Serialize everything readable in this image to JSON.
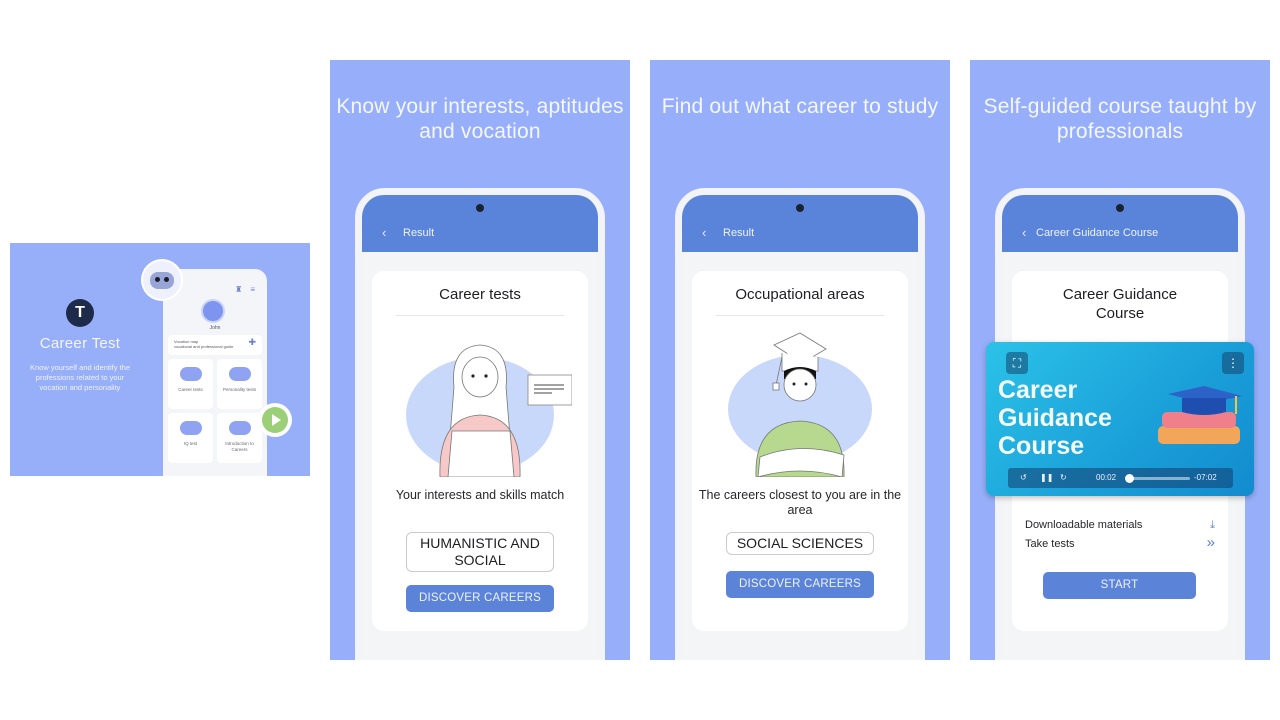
{
  "feature": {
    "logo_glyph": "T",
    "title": "Career Test",
    "description": "Know yourself and identify the professions related to your vocation and personality",
    "phone": {
      "user_name": "John",
      "vocation_map": {
        "title": "Vocation map",
        "subtitle": "vocational and professional guide"
      },
      "tiles": [
        {
          "label": "Career tests",
          "icon": "graduation-cap-icon"
        },
        {
          "label": "Personality tests",
          "icon": "hands-icon"
        },
        {
          "label": "IQ test",
          "icon": "lightbulb-icon"
        },
        {
          "label": "Introduction to Careers",
          "icon": "briefcase-icon"
        }
      ]
    }
  },
  "panels": [
    {
      "headline": "Know your interests, aptitudes and vocation",
      "appbar_title": "Result",
      "card_title": "Career tests",
      "result_label": "Your interests and skills match",
      "result_value": "HUMANISTIC AND SOCIAL",
      "button": "DISCOVER CAREERS"
    },
    {
      "headline": "Find out what career to study",
      "appbar_title": "Result",
      "card_title": "Occupational areas",
      "result_label": "The careers closest to you are in the area",
      "result_value": "SOCIAL SCIENCES",
      "button": "DISCOVER CAREERS"
    },
    {
      "headline": "Self-guided course taught by professionals",
      "appbar_title": "Career Guidance Course",
      "card_title": "Career Guidance Course",
      "video": {
        "title": "Career Guidance Course",
        "elapsed": "00:02",
        "remaining": "-07:02",
        "progress": 0.01
      },
      "rows": [
        {
          "label": "Downloadable materials",
          "icon": "download-icon",
          "glyph": "⤓"
        },
        {
          "label": "Take tests",
          "icon": "double-chevron-right-icon",
          "glyph": "»"
        }
      ],
      "button": "START"
    }
  ],
  "colors": {
    "panel_bg": "#97affa",
    "appbar": "#5a84da",
    "button": "#5b84d9",
    "text_dark": "#1d1d24"
  }
}
